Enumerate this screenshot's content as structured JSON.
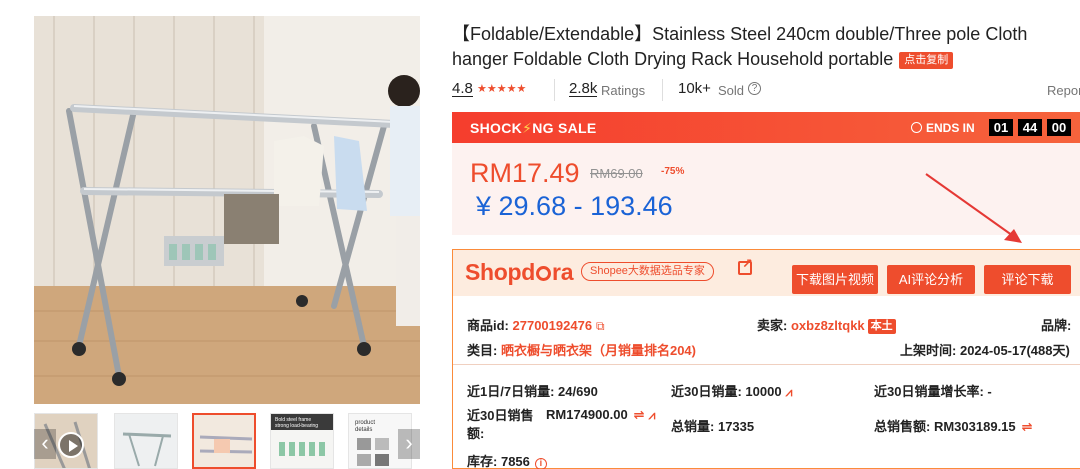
{
  "gallery": {
    "thumb_count": 5,
    "prev_icon": "chevron-left-icon",
    "next_icon": "chevron-right-icon",
    "play_icon": "play-icon",
    "thumb_2_text": "Bold steel frame strong load-bearing",
    "thumb_4_text": "product details"
  },
  "product": {
    "title": "【Foldable/Extendable】Stainless Steel 240cm double/Three pole Cloth hanger Foldable Cloth Drying Rack Household portable",
    "copy_tag": "点击复制",
    "rating": "4.8",
    "stars": "★★★★★",
    "ratings_count": "2.8k",
    "ratings_label": "Ratings",
    "sold_count": "10k+",
    "sold_label": "Sold",
    "report": "Repor"
  },
  "sale": {
    "title_left": "SHOCK",
    "title_right": "NG SALE",
    "ends_in": "ENDS IN",
    "hours": "01",
    "minutes": "44",
    "seconds": "00",
    "price": "RM17.49",
    "old_price": "RM69.00",
    "discount": "-75%",
    "price_cny": "¥ 29.68 - 193.46"
  },
  "shopdora": {
    "logo_left": "Shopd",
    "logo_right": "ra",
    "pill": "Shopee大数据选品专家",
    "btn_download_media": "下载图片视频",
    "btn_ai_review": "AI评论分析",
    "btn_review_download": "评论下载",
    "product_id_label": "商品id:",
    "product_id": "27700192476",
    "seller_label": "卖家:",
    "seller": "oxbz8zltqkk",
    "local_badge": "本土",
    "brand_label": "品牌:",
    "category_label": "类目:",
    "category": "晒衣橱与晒衣架（月销量排名204)",
    "listed_label": "上架时间:",
    "listed": "2024-05-17(488天)",
    "sales_1_7_label": "近1日/7日销量:",
    "sales_1_7": "24/690",
    "sales_30_label": "近30日销量:",
    "sales_30": "10000",
    "growth_label": "近30日销量增长率:",
    "growth": "-",
    "revenue_30_label_a": "近30日销售",
    "revenue_30_label_b": "额:",
    "revenue_30": "RM174900.00",
    "total_sales_label": "总销量:",
    "total_sales": "17335",
    "total_revenue_label": "总销售额:",
    "total_revenue": "RM303189.15",
    "stock_label": "库存:",
    "stock": "7856"
  },
  "colors": {
    "accent": "#ee4d2d",
    "price_cny": "#1a63d6",
    "sale_bg": "#f53d2d",
    "price_bg": "#fdf2f0"
  }
}
